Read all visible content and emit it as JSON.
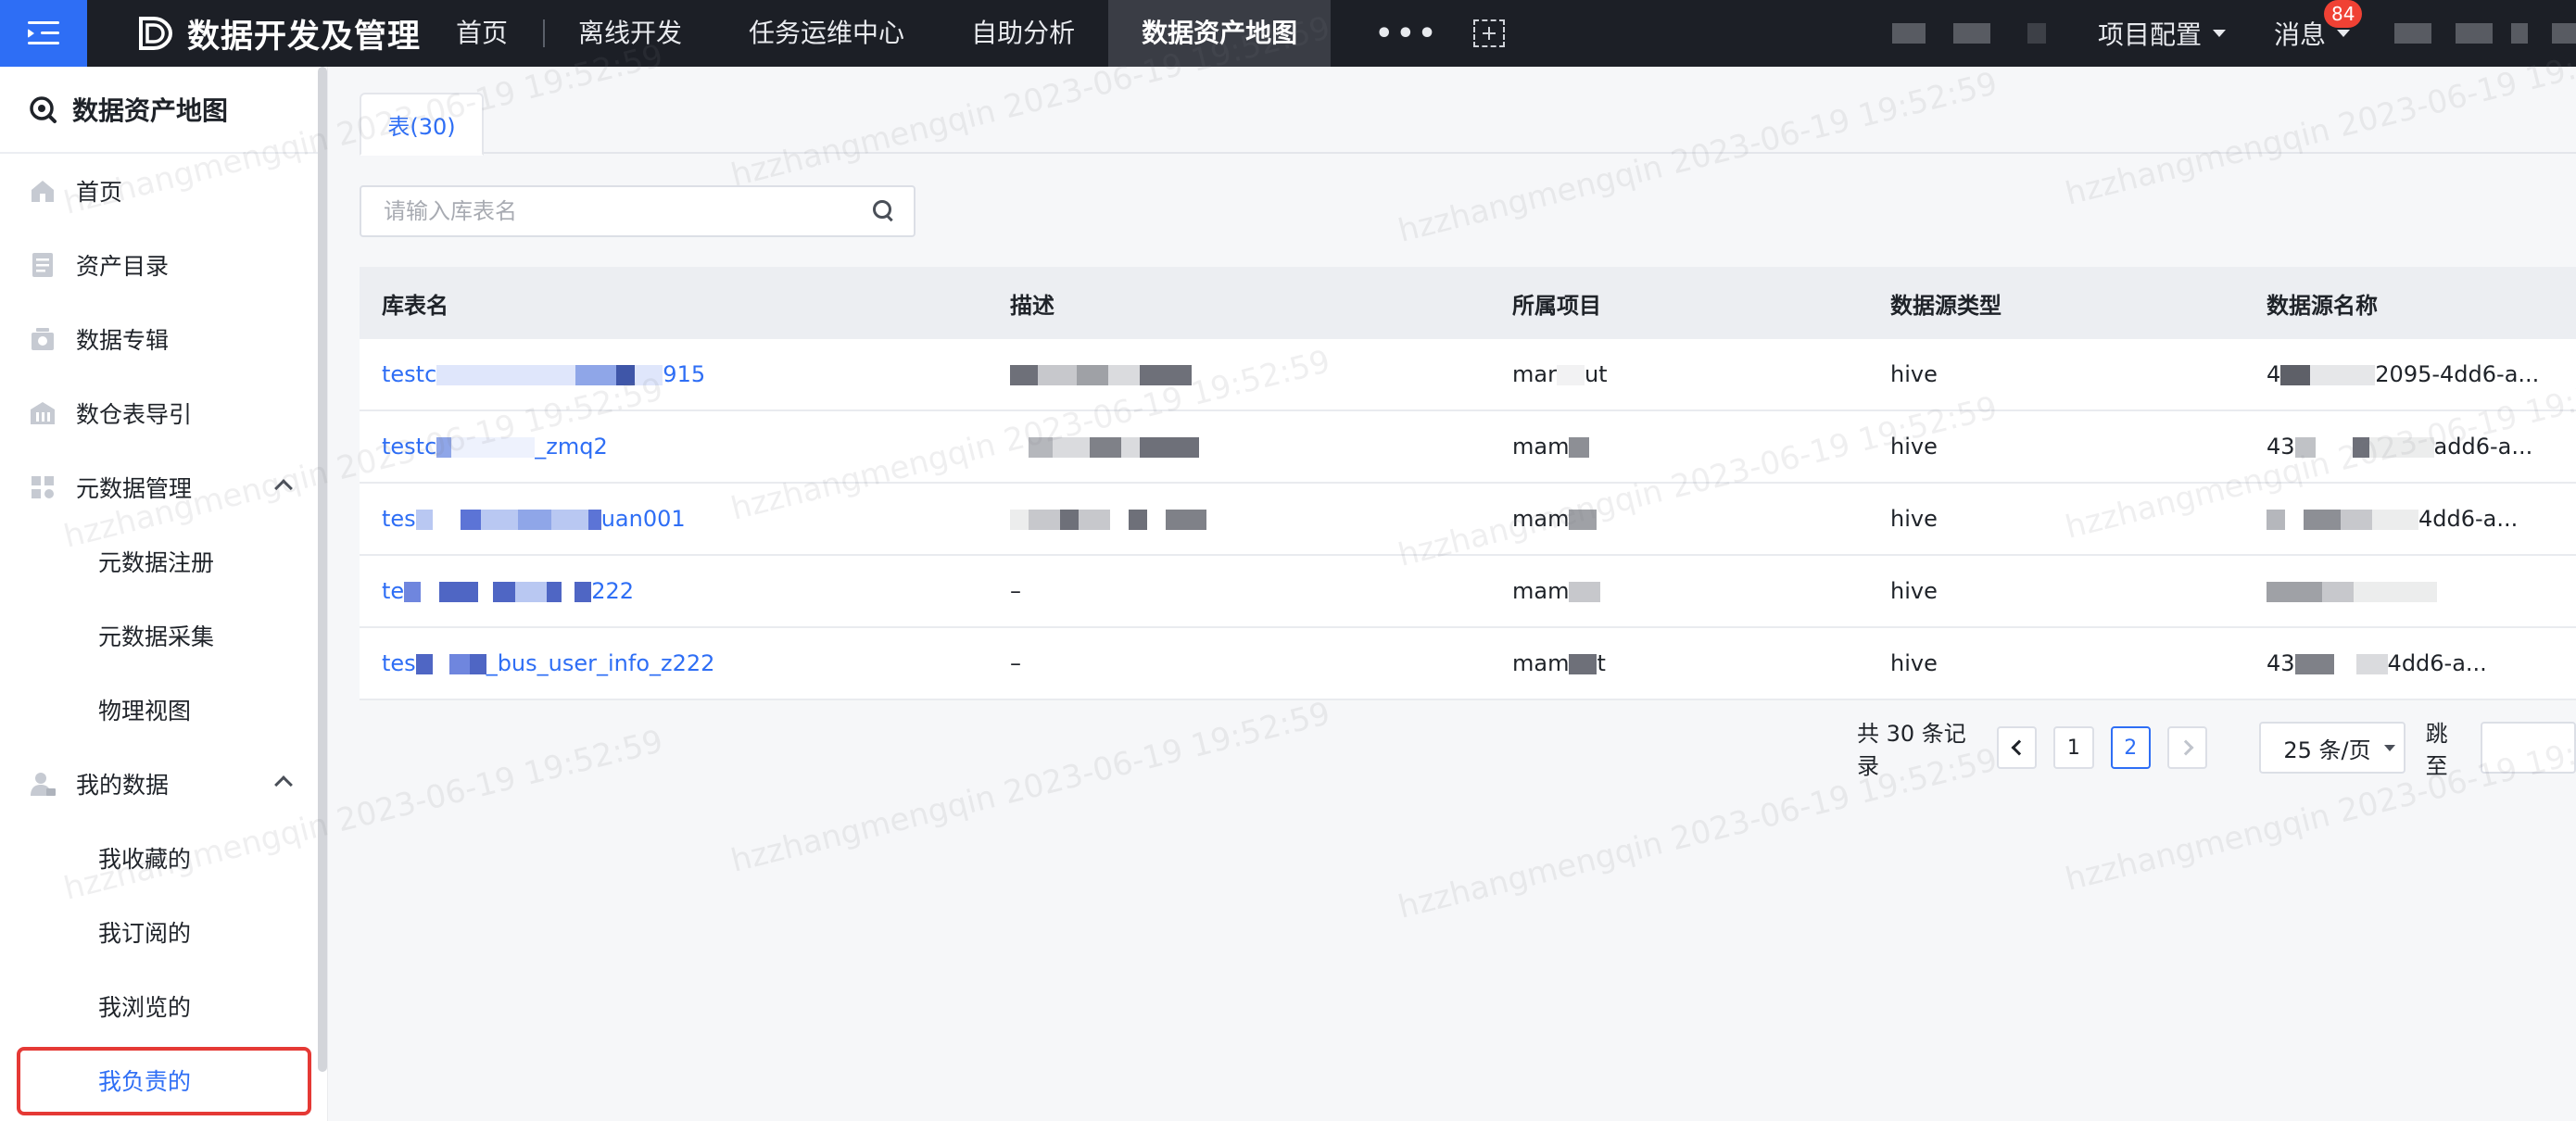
{
  "topbar": {
    "brand_title": "数据开发及管理",
    "nav": [
      "首页",
      "离线开发",
      "任务运维中心",
      "自助分析",
      "数据资产地图"
    ],
    "more": "•••",
    "project_config": "项目配置",
    "messages": "消息",
    "messages_badge": "84",
    "accent_color": "#2e6ef5",
    "bar_color": "#1c1f26"
  },
  "sidebar": {
    "title": "数据资产地图",
    "items": [
      {
        "label": "首页",
        "icon": "home-icon"
      },
      {
        "label": "资产目录",
        "icon": "catalog-icon"
      },
      {
        "label": "数据专辑",
        "icon": "album-icon"
      },
      {
        "label": "数仓表导引",
        "icon": "warehouse-icon"
      },
      {
        "label": "元数据管理",
        "icon": "grid-icon"
      },
      {
        "label": "元数据注册"
      },
      {
        "label": "元数据采集"
      },
      {
        "label": "物理视图"
      },
      {
        "label": "我的数据",
        "icon": "user-icon"
      },
      {
        "label": "我收藏的"
      },
      {
        "label": "我订阅的"
      },
      {
        "label": "我浏览的"
      },
      {
        "label": "我负责的"
      }
    ]
  },
  "main": {
    "tab_label": "表(30)",
    "search_placeholder": "请输入库表名",
    "columns": [
      "库表名",
      "描述",
      "所属项目",
      "数据源类型",
      "数据源名称"
    ],
    "rows": [
      {
        "name_start": "testc",
        "name_end": "915",
        "desc": "",
        "project_start": "mar",
        "project_end": "ut",
        "source_type": "hive",
        "source_start": "4",
        "source_end": "2095-4dd6-a..."
      },
      {
        "name_start": "testc",
        "name_end": "_zmq2",
        "desc": "",
        "project_start": "mam",
        "project_end": "",
        "source_type": "hive",
        "source_start": "43",
        "source_end": "add6-a..."
      },
      {
        "name_start": "tes",
        "name_end": "uan001",
        "desc": "",
        "project_start": "mam",
        "project_end": "",
        "source_type": "hive",
        "source_start": "",
        "source_end": "4dd6-a..."
      },
      {
        "name_start": "te",
        "name_end": "222",
        "desc": "–",
        "project_start": "mam",
        "project_end": "",
        "source_type": "hive",
        "source_start": "",
        "source_end": ""
      },
      {
        "name_start": "tes",
        "name_end": "_bus_user_info_z222",
        "desc": "–",
        "project_start": "mam",
        "project_end": "t",
        "source_type": "hive",
        "source_start": "43",
        "source_end": "4dd6-a..."
      }
    ],
    "pager": {
      "total": "共 30 条记录",
      "pages": [
        "1",
        "2"
      ],
      "current": "2",
      "page_size": "25 条/页",
      "jump": "跳至"
    }
  },
  "watermark": "hzzhangmengqin 2023-06-19 19:52:59"
}
